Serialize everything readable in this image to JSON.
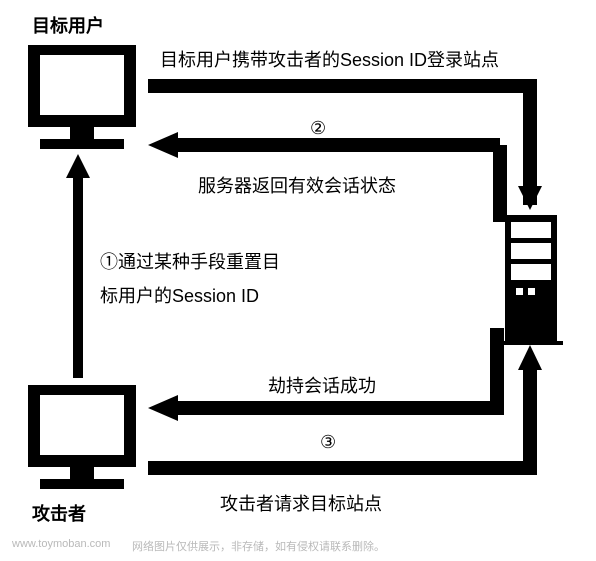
{
  "labels": {
    "target_user": "目标用户",
    "attacker": "攻击者",
    "arrow1_line1": "①通过某种手段重置目",
    "arrow1_line2": "标用户的Session ID",
    "arrow2_label": "目标用户携带攻击者的Session ID登录站点",
    "arrow2_return_label": "服务器返回有效会话状态",
    "arrow3_label": "攻击者请求目标站点",
    "arrow3_return_label": "劫持会话成功",
    "step2": "②",
    "step3": "③"
  },
  "footer": {
    "domain": "www.toymoban.com",
    "note": "网络图片仅供展示，非存储，如有侵权请联系删除。"
  }
}
